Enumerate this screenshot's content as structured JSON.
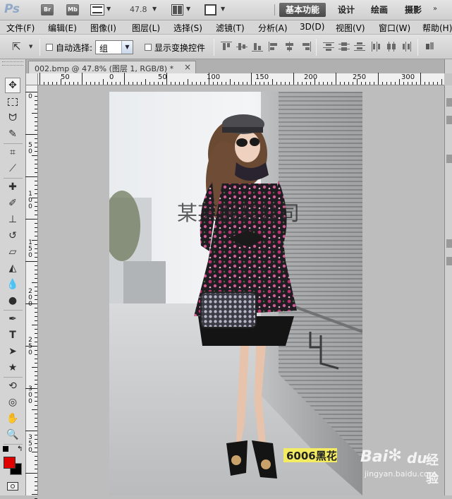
{
  "app": {
    "logo": "Ps",
    "bridge_label": "Br",
    "minibridge_label": "Mb",
    "zoom_value": "47.8",
    "workspaces": [
      "基本功能",
      "设计",
      "绘画",
      "摄影"
    ]
  },
  "menu": [
    "文件(F)",
    "编辑(E)",
    "图像(I)",
    "图层(L)",
    "选择(S)",
    "滤镜(T)",
    "分析(A)",
    "3D(D)",
    "视图(V)",
    "窗口(W)",
    "帮助(H)"
  ],
  "options": {
    "auto_select_label": "自动选择:",
    "auto_select_value": "组",
    "show_transform_label": "显示变换控件"
  },
  "document": {
    "tab_title": "002.bmp @ 47.8% (图层 1, RGB/8) *",
    "close_glyph": "×"
  },
  "ruler": {
    "h_labels": [
      "50",
      "0",
      "50",
      "100",
      "150",
      "200",
      "250",
      "300"
    ],
    "v_labels": [
      "0",
      "5\n0",
      "1\n0\n0",
      "1\n5\n0",
      "2\n0\n0",
      "2\n5\n0",
      "3\n0\n0",
      "3\n5\n0",
      "4\n0\n0",
      "4\n5\n0"
    ]
  },
  "photo": {
    "watermark_text": "某某服装公司",
    "tag_text": "6006黑花",
    "baidu_logo": "Bai",
    "baidu_logo_du": "du",
    "baidu_experience": "经验",
    "baidu_url": "jingyan.baidu.com"
  },
  "colors": {
    "foreground": "#e00000",
    "background": "#000000",
    "accent": "#4a4a4a"
  },
  "icons": [
    "move-icon",
    "marquee-icon",
    "lasso-icon",
    "quick-select-icon",
    "crop-icon",
    "eyedropper-icon",
    "healing-brush-icon",
    "brush-icon",
    "clone-stamp-icon",
    "history-brush-icon",
    "eraser-icon",
    "paint-bucket-icon",
    "blur-icon",
    "dodge-icon",
    "pen-icon",
    "type-icon",
    "path-select-icon",
    "shape-icon",
    "3d-rotate-icon",
    "3d-orbit-icon",
    "hand-icon",
    "zoom-icon"
  ]
}
